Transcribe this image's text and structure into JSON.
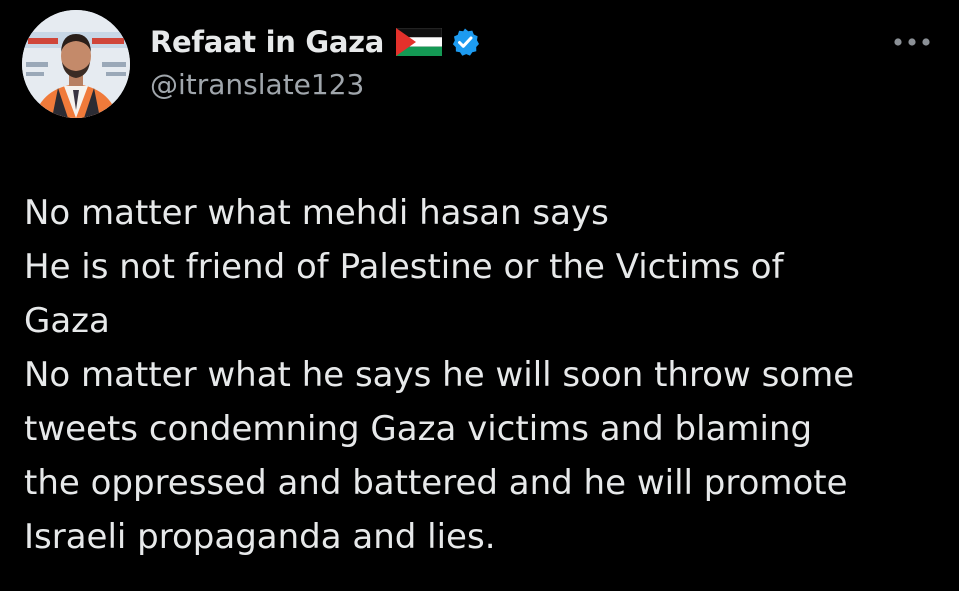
{
  "author": {
    "display_name": "Refaat in Gaza",
    "handle": "@itranslate123",
    "flag_icon": "palestine-flag-icon",
    "verified_icon": "verified-badge-icon",
    "verified_color": "#1d9bf0"
  },
  "menu": {
    "icon": "more-options-icon"
  },
  "tweet": {
    "lines": [
      "No matter what mehdi hasan says",
      "He is not friend of Palestine or the Victims of",
      "Gaza",
      "No matter what he says he will soon throw some",
      "tweets condemning Gaza victims and blaming",
      "the oppressed and battered and he will promote",
      "Israeli propaganda and lies."
    ]
  },
  "colors": {
    "background": "#000000",
    "primary_text": "#e7e9ea",
    "secondary_text": "#a0a6ac"
  }
}
